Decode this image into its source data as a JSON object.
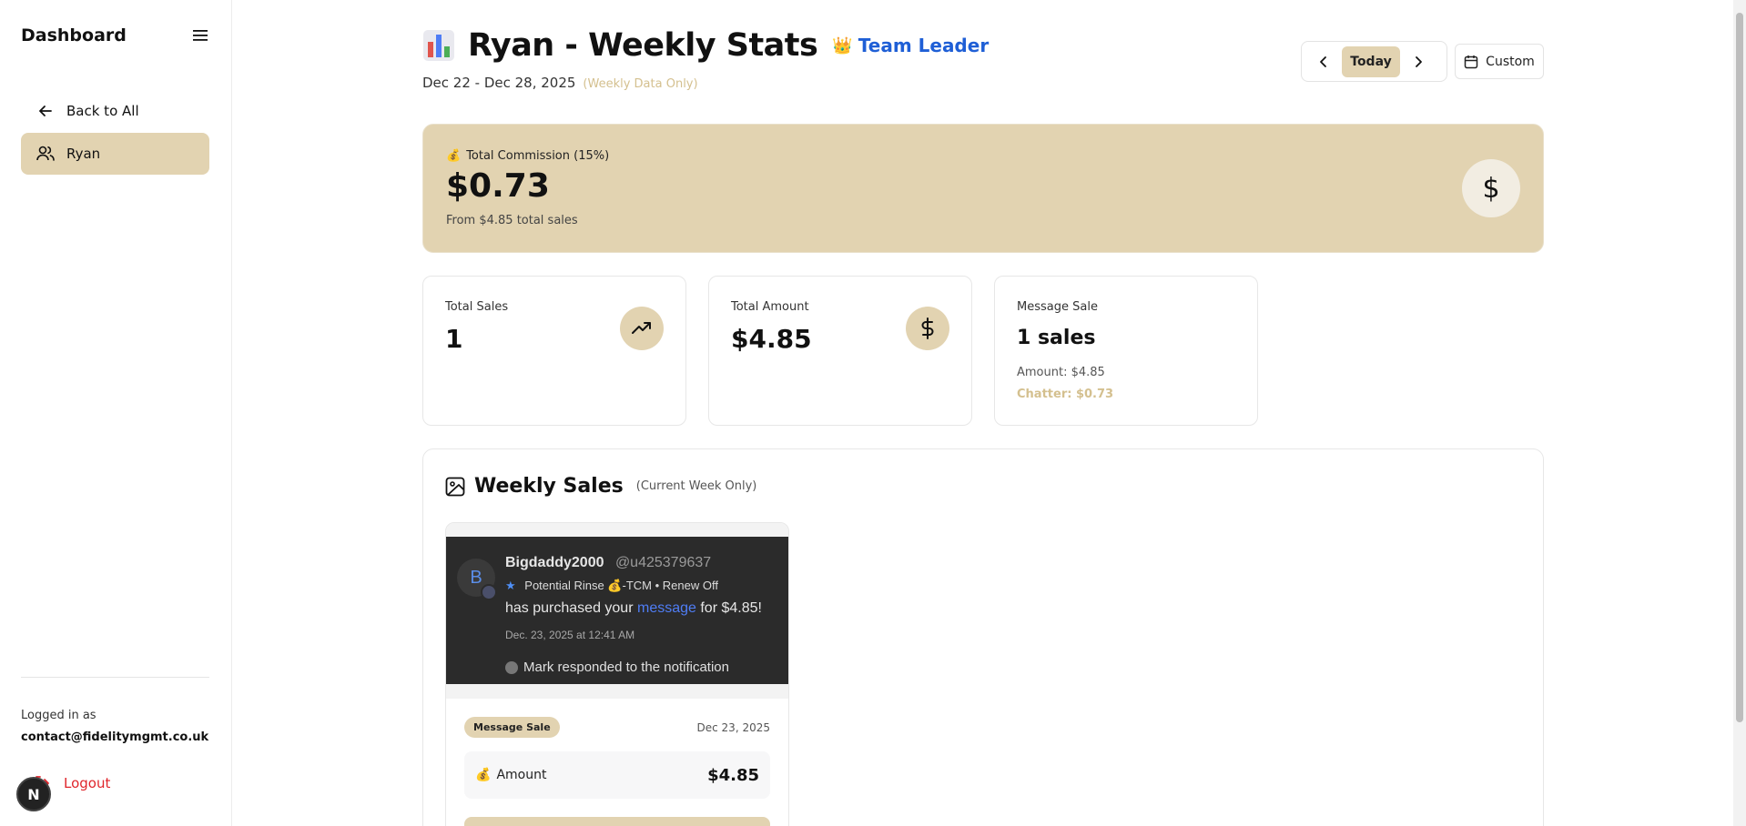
{
  "sidebar": {
    "title": "Dashboard",
    "items": [
      {
        "label": "Back to All",
        "icon": "arrow-left-icon"
      },
      {
        "label": "Ryan",
        "icon": "users-icon",
        "active": true
      }
    ],
    "logged_in_label": "Logged in as",
    "email": "contact@fidelitymgmt.co.uk",
    "logout_label": "Logout",
    "avatar_letter": "N"
  },
  "header": {
    "title": "Ryan - Weekly Stats",
    "crown": "👑",
    "role": "Team Leader",
    "date_range": "Dec 22 - Dec 28, 2025",
    "weekly_note": "(Weekly Data Only)",
    "today_label": "Today",
    "custom_label": "Custom"
  },
  "commission": {
    "emoji": "💰",
    "label": "Total Commission (15%)",
    "value": "$0.73",
    "sub": "From $4.85 total sales",
    "icon_symbol": "$"
  },
  "stats": {
    "total_sales": {
      "label": "Total Sales",
      "value": "1"
    },
    "total_amount": {
      "label": "Total Amount",
      "value": "$4.85"
    },
    "message_sale": {
      "label": "Message Sale",
      "value": "1 sales",
      "amount": "Amount: $4.85",
      "chatter": "Chatter: $0.73"
    }
  },
  "weekly_sales": {
    "title": "Weekly Sales",
    "subtitle": "(Current Week Only)",
    "card": {
      "notification": {
        "avatar_letter": "B",
        "username": "Bigdaddy2000",
        "handle": "@u425379637",
        "tag_star": "★",
        "tag": "Potential Rinse 💰-TCM • Renew Off",
        "msg_prefix": "has purchased your",
        "msg_link": "message",
        "msg_suffix": "for $4.85!",
        "date": "Dec. 23, 2025 at 12:41 AM",
        "responder": "Mark",
        "response_text": "responded to the notification"
      },
      "type_badge": "Message Sale",
      "date": "Dec 23, 2025",
      "amount_emoji": "💰",
      "amount_label": "Amount",
      "amount_value": "$4.85"
    }
  },
  "colors": {
    "accent": "#e2d3b1",
    "role_blue": "#1f5fd6",
    "logout_red": "#e0262c",
    "muted_gold": "#d4c08f"
  }
}
